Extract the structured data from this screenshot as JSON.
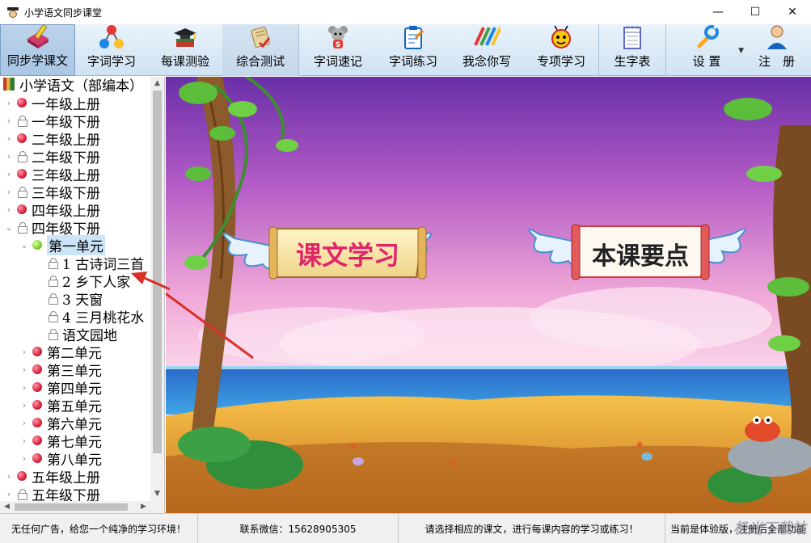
{
  "window": {
    "title": "小学语文同步课堂",
    "controls": [
      "—",
      "☐",
      "✕"
    ]
  },
  "toolbar": {
    "items": [
      {
        "label": "同步学课文",
        "icon": "book-pen-icon"
      },
      {
        "label": "字词学习",
        "icon": "molecule-icon"
      },
      {
        "label": "每课测验",
        "icon": "grad-cap-icon"
      },
      {
        "label": "综合测试",
        "icon": "scroll-icon"
      },
      {
        "label": "字词速记",
        "icon": "mouse-character-icon"
      },
      {
        "label": "字词练习",
        "icon": "clipboard-icon"
      },
      {
        "label": "我念你写",
        "icon": "pencils-icon"
      },
      {
        "label": "专项学习",
        "icon": "ladybug-icon"
      },
      {
        "label": "生字表",
        "icon": "notepad-icon"
      },
      {
        "label": "设 置",
        "icon": "wrench-icon"
      },
      {
        "label": "注　册",
        "icon": "user-icon"
      }
    ]
  },
  "tree": {
    "root": "小学语文（部编本）",
    "nodes": [
      {
        "label": "一年级上册",
        "icon": "red"
      },
      {
        "label": "一年级下册",
        "icon": "lock"
      },
      {
        "label": "二年级上册",
        "icon": "red"
      },
      {
        "label": "二年级下册",
        "icon": "lock"
      },
      {
        "label": "三年级上册",
        "icon": "red"
      },
      {
        "label": "三年级下册",
        "icon": "lock"
      },
      {
        "label": "四年级上册",
        "icon": "red"
      },
      {
        "label": "四年级下册",
        "icon": "lock"
      },
      {
        "label": "第一单元",
        "icon": "green"
      },
      {
        "label": "1  古诗词三首",
        "icon": "lock"
      },
      {
        "label": "2  乡下人家",
        "icon": "lock"
      },
      {
        "label": "3  天窗",
        "icon": "lock"
      },
      {
        "label": "4  三月桃花水",
        "icon": "lock"
      },
      {
        "label": "语文园地",
        "icon": "lock"
      },
      {
        "label": "第二单元",
        "icon": "red"
      },
      {
        "label": "第三单元",
        "icon": "red"
      },
      {
        "label": "第四单元",
        "icon": "red"
      },
      {
        "label": "第五单元",
        "icon": "red"
      },
      {
        "label": "第六单元",
        "icon": "red"
      },
      {
        "label": "第七单元",
        "icon": "red"
      },
      {
        "label": "第八单元",
        "icon": "red"
      },
      {
        "label": "五年级上册",
        "icon": "red"
      },
      {
        "label": "五年级下册",
        "icon": "lock"
      }
    ]
  },
  "scene": {
    "banner_left": "课文学习",
    "banner_right": "本课要点"
  },
  "status": {
    "seg1": "无任何广告，给您一个纯净的学习环境！",
    "seg2": "联系微信：15628905305",
    "seg3": "请选择相应的课文，进行每课内容的学习或练习！",
    "seg4": "当前是体验版，注册后全部功能",
    "watermark": "极光下载站"
  },
  "colors": {
    "toolbar_top": "#eaf3fb",
    "toolbar_bottom": "#cfe2f3",
    "selected_bg": "#cce4f7",
    "arrow": "#d9302a"
  }
}
